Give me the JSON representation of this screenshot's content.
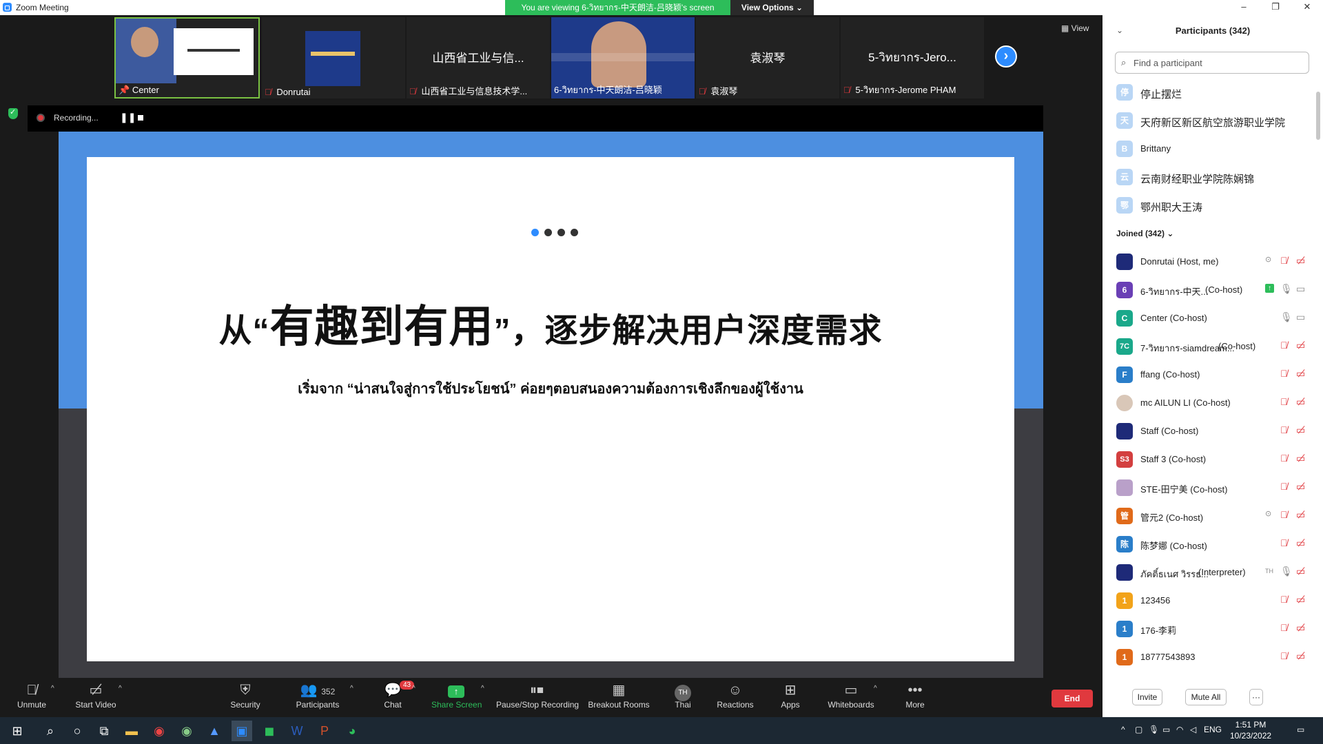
{
  "window": {
    "title": "Zoom Meeting",
    "minimize": "–",
    "restore": "❐",
    "close": "✕"
  },
  "banner": {
    "viewing": "You are viewing 6-วิทยากร-中天朗洁-吕晓颖's screen",
    "view_options": "View Options ⌄"
  },
  "view_button": "▦ View",
  "thumbnails": [
    {
      "name": "Center",
      "pinned": true,
      "active": true,
      "big": ""
    },
    {
      "name": "Donrutai",
      "muted": true,
      "big": ""
    },
    {
      "name": "山西省工业与信息技术学...",
      "muted": true,
      "big": "山西省工业与信..."
    },
    {
      "name": "6-วิทยากร-中天朗洁-吕晓颖",
      "big": ""
    },
    {
      "name": "袁淑琴",
      "muted": true,
      "big": "袁淑琴"
    },
    {
      "name": "5-วิทยากร-Jerome PHAM",
      "muted": true,
      "big": "5-วิทยากร-Jero..."
    }
  ],
  "recording": {
    "label": "Recording...",
    "pause": "❚❚"
  },
  "slide": {
    "title_pre": "从“",
    "title_big": "有趣到有用",
    "title_post": "”，逐步解决用户深度需求",
    "subtitle": "เริ่มจาก “น่าสนใจสู่การใช้ประโยชน์” ค่อยๆตอบสนองความต้องการเชิงลึกของผู้ใช้งาน"
  },
  "toolbar": {
    "unmute": "Unmute",
    "start_video": "Start Video",
    "security": "Security",
    "participants": "Participants",
    "participants_count": "352",
    "chat": "Chat",
    "chat_badge": "43",
    "share_screen": "Share Screen",
    "pause_recording": "Pause/Stop Recording",
    "breakout": "Breakout Rooms",
    "thai": "Thai",
    "thai_icon": "TH",
    "reactions": "Reactions",
    "apps": "Apps",
    "whiteboards": "Whiteboards",
    "more": "More",
    "end": "End"
  },
  "panel": {
    "title": "Participants (342)",
    "search_placeholder": "Find a participant",
    "waiting": [
      {
        "initial": "停",
        "name": "停止摆烂",
        "color": "#b9d6f5"
      },
      {
        "initial": "天",
        "name": "天府新区新区航空旅游职业学院",
        "color": "#b9d6f5"
      },
      {
        "initial": "B",
        "name": "Brittany",
        "color": "#b9d6f5"
      },
      {
        "initial": "云",
        "name": "云南财经职业学院陈娴锦",
        "color": "#b9d6f5"
      },
      {
        "initial": "鄂",
        "name": "鄂州职大王涛",
        "color": "#b9d6f5"
      }
    ],
    "joined_label": "Joined (342) ⌄",
    "joined": [
      {
        "initial": "",
        "name": "Donrutai (Host, me)",
        "role": "",
        "color": "#1e2a78",
        "rec": true
      },
      {
        "initial": "6",
        "name": "6-วิทยากร-中天...",
        "role": "(Co-host)",
        "color": "#6a3fb5",
        "share": true,
        "mic_on": true
      },
      {
        "initial": "C",
        "name": "Center (Co-host)",
        "role": "",
        "color": "#1aa88a",
        "mic_on": true
      },
      {
        "initial": "7C",
        "name": "7-วิทยากร-siamdream...",
        "role": "(Co-host)",
        "color": "#1aa88a"
      },
      {
        "initial": "F",
        "name": "ffang (Co-host)",
        "role": "",
        "color": "#2a7ec9"
      },
      {
        "initial": "",
        "name": "mc AILUN LI (Co-host)",
        "role": "",
        "color": "#d9c7b8"
      },
      {
        "initial": "",
        "name": "Staff (Co-host)",
        "role": "",
        "color": "#1e2a78"
      },
      {
        "initial": "S3",
        "name": "Staff 3 (Co-host)",
        "role": "",
        "color": "#d33f3f"
      },
      {
        "initial": "",
        "name": "STE-田宁美 (Co-host)",
        "role": "",
        "color": "#b9a0c9"
      },
      {
        "initial": "管",
        "name": "管元2 (Co-host)",
        "role": "",
        "color": "#e06a1a",
        "rec": true
      },
      {
        "initial": "陈",
        "name": "陈梦娜 (Co-host)",
        "role": "",
        "color": "#2a7ec9"
      },
      {
        "initial": "",
        "name": "ภัคติ์ธเนศ วิรรธ...",
        "role": "(Interpreter)",
        "color": "#1e2a78",
        "mic_on": true,
        "interp": "TH"
      },
      {
        "initial": "1",
        "name": "123456",
        "role": "",
        "color": "#f2a31a"
      },
      {
        "initial": "1",
        "name": "176-李莉",
        "role": "",
        "color": "#2a7ec9"
      },
      {
        "initial": "1",
        "name": "18777543893",
        "role": "",
        "color": "#e06a1a"
      }
    ],
    "invite": "Invite",
    "mute_all": "Mute All",
    "more": "···"
  },
  "taskbar": {
    "lang": "ENG",
    "time": "1:51 PM",
    "date": "10/23/2022"
  }
}
